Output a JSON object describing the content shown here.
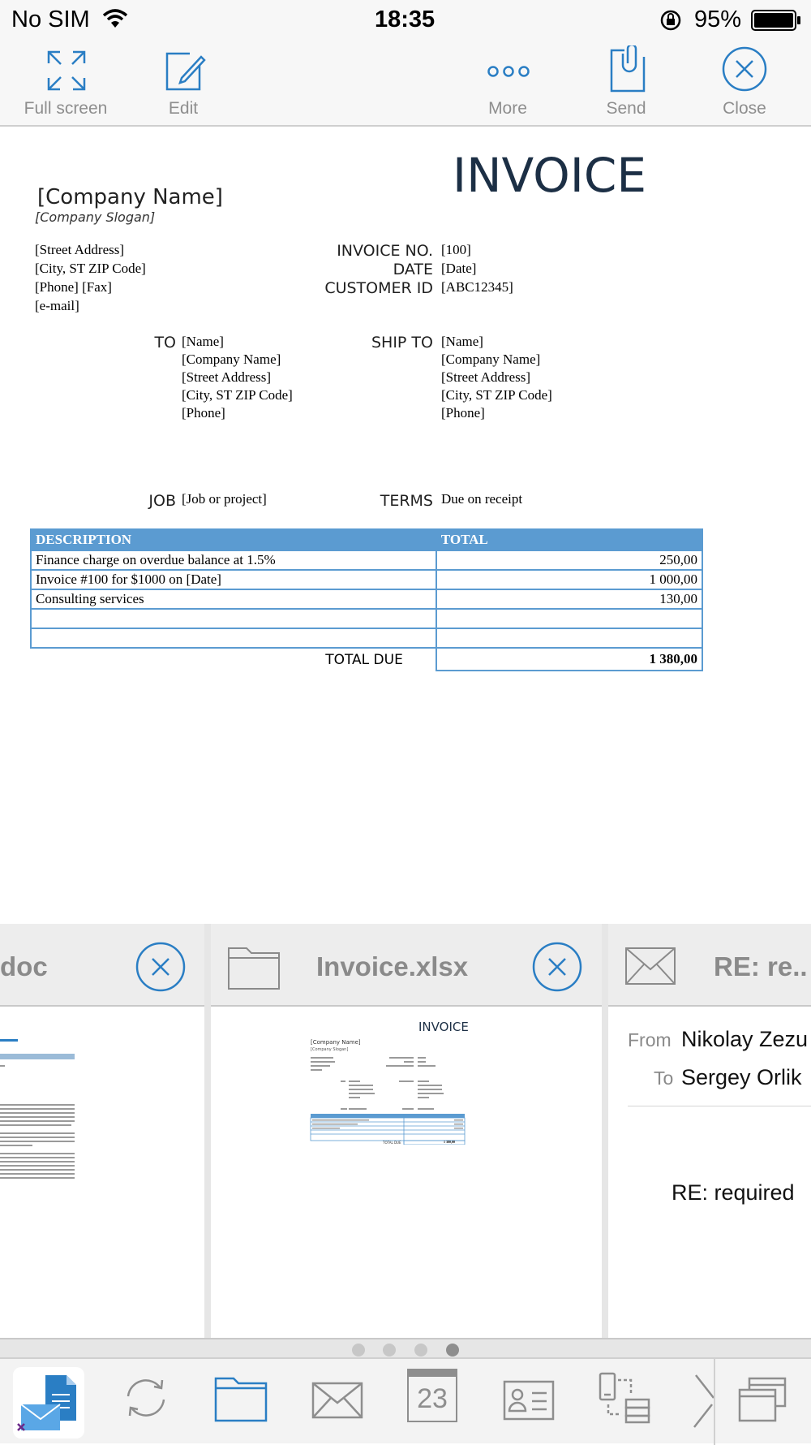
{
  "status_bar": {
    "carrier": "No SIM",
    "time": "18:35",
    "battery": "95%"
  },
  "toolbar": {
    "full_screen": "Full screen",
    "edit": "Edit",
    "more": "More",
    "send": "Send",
    "close": "Close"
  },
  "invoice": {
    "title": "INVOICE",
    "company_name": "[Company Name]",
    "company_slogan": "[Company Slogan]",
    "address_lines": [
      "[Street Address]",
      "[City, ST  ZIP Code]",
      "[Phone] [Fax]",
      "[e-mail]"
    ],
    "meta_labels": [
      "INVOICE NO.",
      "DATE",
      "CUSTOMER ID"
    ],
    "meta_values": [
      "[100]",
      "[Date]",
      "[ABC12345]"
    ],
    "to_label": "TO",
    "to_lines": [
      "[Name]",
      "[Company Name]",
      "[Street Address]",
      "[City, ST  ZIP Code]",
      "[Phone]"
    ],
    "ship_to_label": "SHIP TO",
    "ship_to_lines": [
      "[Name]",
      "[Company Name]",
      "[Street Address]",
      "[City, ST  ZIP Code]",
      "[Phone]"
    ],
    "job_label": "JOB",
    "job_value": "[Job or project]",
    "terms_label": "TERMS",
    "terms_value": "Due on receipt",
    "columns": [
      "DESCRIPTION",
      "TOTAL"
    ],
    "rows": [
      {
        "description": "Finance charge on overdue balance at 1.5%",
        "total": "250,00"
      },
      {
        "description": "Invoice #100 for $1000 on [Date]",
        "total": "1 000,00"
      },
      {
        "description": "Consulting services",
        "total": "130,00"
      },
      {
        "description": "",
        "total": ""
      },
      {
        "description": "",
        "total": ""
      }
    ],
    "total_due_label": "TOTAL DUE",
    "total_due_value": "1 380,00"
  },
  "cards": {
    "left_title": "doc",
    "middle_title": "Invoice.xlsx",
    "right_title": "RE: re..",
    "mini_invoice": {
      "title": "INVOICE",
      "company": "[Company Name]",
      "slogan": "[Company Slogan]",
      "total_due": "TOTAL DUE",
      "total_value": "1 380,00"
    },
    "email": {
      "from_label": "From",
      "from_name": "Nikolay Zezu",
      "to_label": "To",
      "to_name": "Sergey Orlik",
      "subject": "RE: required"
    }
  },
  "pager": {
    "count": 4,
    "active_index": 3
  },
  "dock": {
    "calendar_day": "23"
  },
  "colors": {
    "accent": "#2a7ec4",
    "table_header": "#5b9bd1",
    "invoice_title": "#1c2f45"
  }
}
